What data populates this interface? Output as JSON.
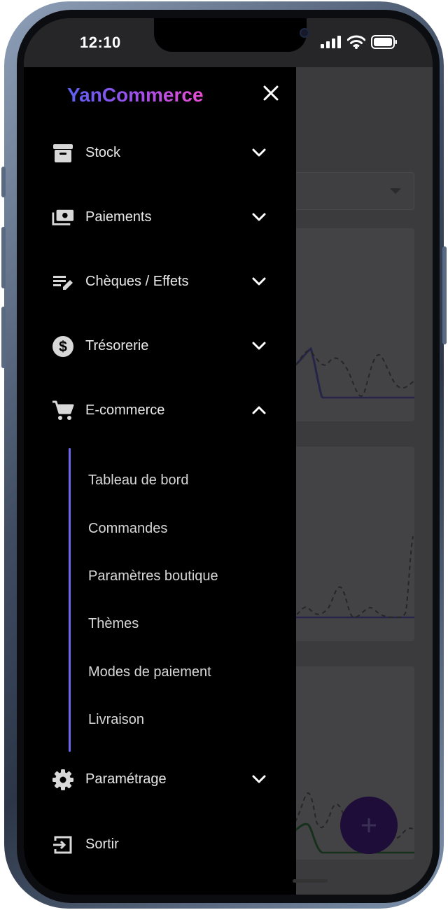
{
  "status_bar": {
    "time": "12:10"
  },
  "drawer": {
    "brand": "YanCommerce",
    "brand_colors": [
      "#5b5ff2",
      "#a44fe8",
      "#e74fd1"
    ],
    "items": [
      {
        "label": "Stock",
        "icon": "archive-icon",
        "expanded": false
      },
      {
        "label": "Paiements",
        "icon": "payments-icon",
        "expanded": false
      },
      {
        "label": "Chèques / Effets",
        "icon": "edit-note-icon",
        "expanded": false
      },
      {
        "label": "Trésorerie",
        "icon": "dollar-circle-icon",
        "expanded": false
      },
      {
        "label": "E-commerce",
        "icon": "cart-icon",
        "expanded": true
      },
      {
        "label": "Paramétrage",
        "icon": "gear-icon",
        "expanded": false
      },
      {
        "label": "Sortir",
        "icon": "exit-icon"
      }
    ],
    "ecommerce_submenu": [
      "Tableau de bord",
      "Commandes",
      "Paramètres boutique",
      "Thèmes",
      "Modes de paiement",
      "Livraison"
    ],
    "accent_color": "#6b66f0"
  },
  "fab": {
    "label": "+"
  }
}
